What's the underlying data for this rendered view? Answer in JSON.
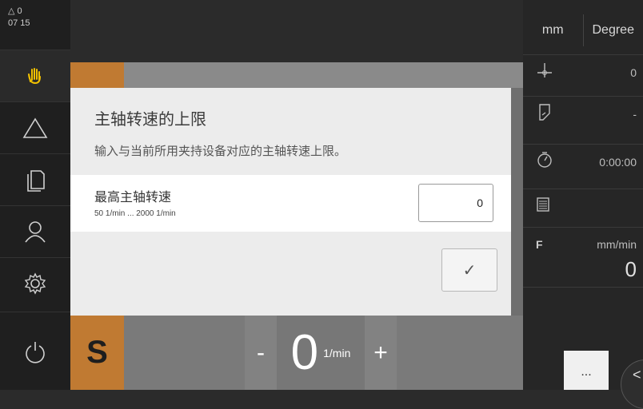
{
  "status": {
    "warning_count": "0",
    "time": "07 15"
  },
  "sidebar": {
    "items": [
      {
        "icon": "hand-icon",
        "active": true
      },
      {
        "icon": "triangle-icon"
      },
      {
        "icon": "document-icon"
      },
      {
        "icon": "user-icon"
      },
      {
        "icon": "gear-icon"
      },
      {
        "icon": "power-icon"
      }
    ]
  },
  "spindle": {
    "label": "S",
    "minus": "-",
    "plus": "+",
    "value": "0",
    "unit": "1/min"
  },
  "right_panel": {
    "unit_linear": "mm",
    "unit_angle": "Degree",
    "rows": [
      {
        "icon": "datum-icon",
        "value": "0"
      },
      {
        "icon": "tool-icon",
        "value": "-"
      },
      {
        "icon": "stopwatch-icon",
        "value": "0:00:00"
      },
      {
        "icon": "calculator-icon",
        "value": ""
      }
    ],
    "feed_label": "F",
    "feed_unit": "mm/min",
    "feed_value": "0",
    "more_button": "...",
    "collapse_icon": "<"
  },
  "dialog": {
    "title": "主轴转速的上限",
    "description": "输入与当前所用夹持设备对应的主轴转速上限。",
    "field_label": "最高主轴转速",
    "field_range": "50 1/min ... 2000 1/min",
    "field_value": "0",
    "ok_icon": "✓"
  },
  "colors": {
    "accent_orange": "#c07a32",
    "sidebar_bg": "#1f1f1f",
    "right_bg": "#262626",
    "dialog_bg": "#ececec"
  }
}
